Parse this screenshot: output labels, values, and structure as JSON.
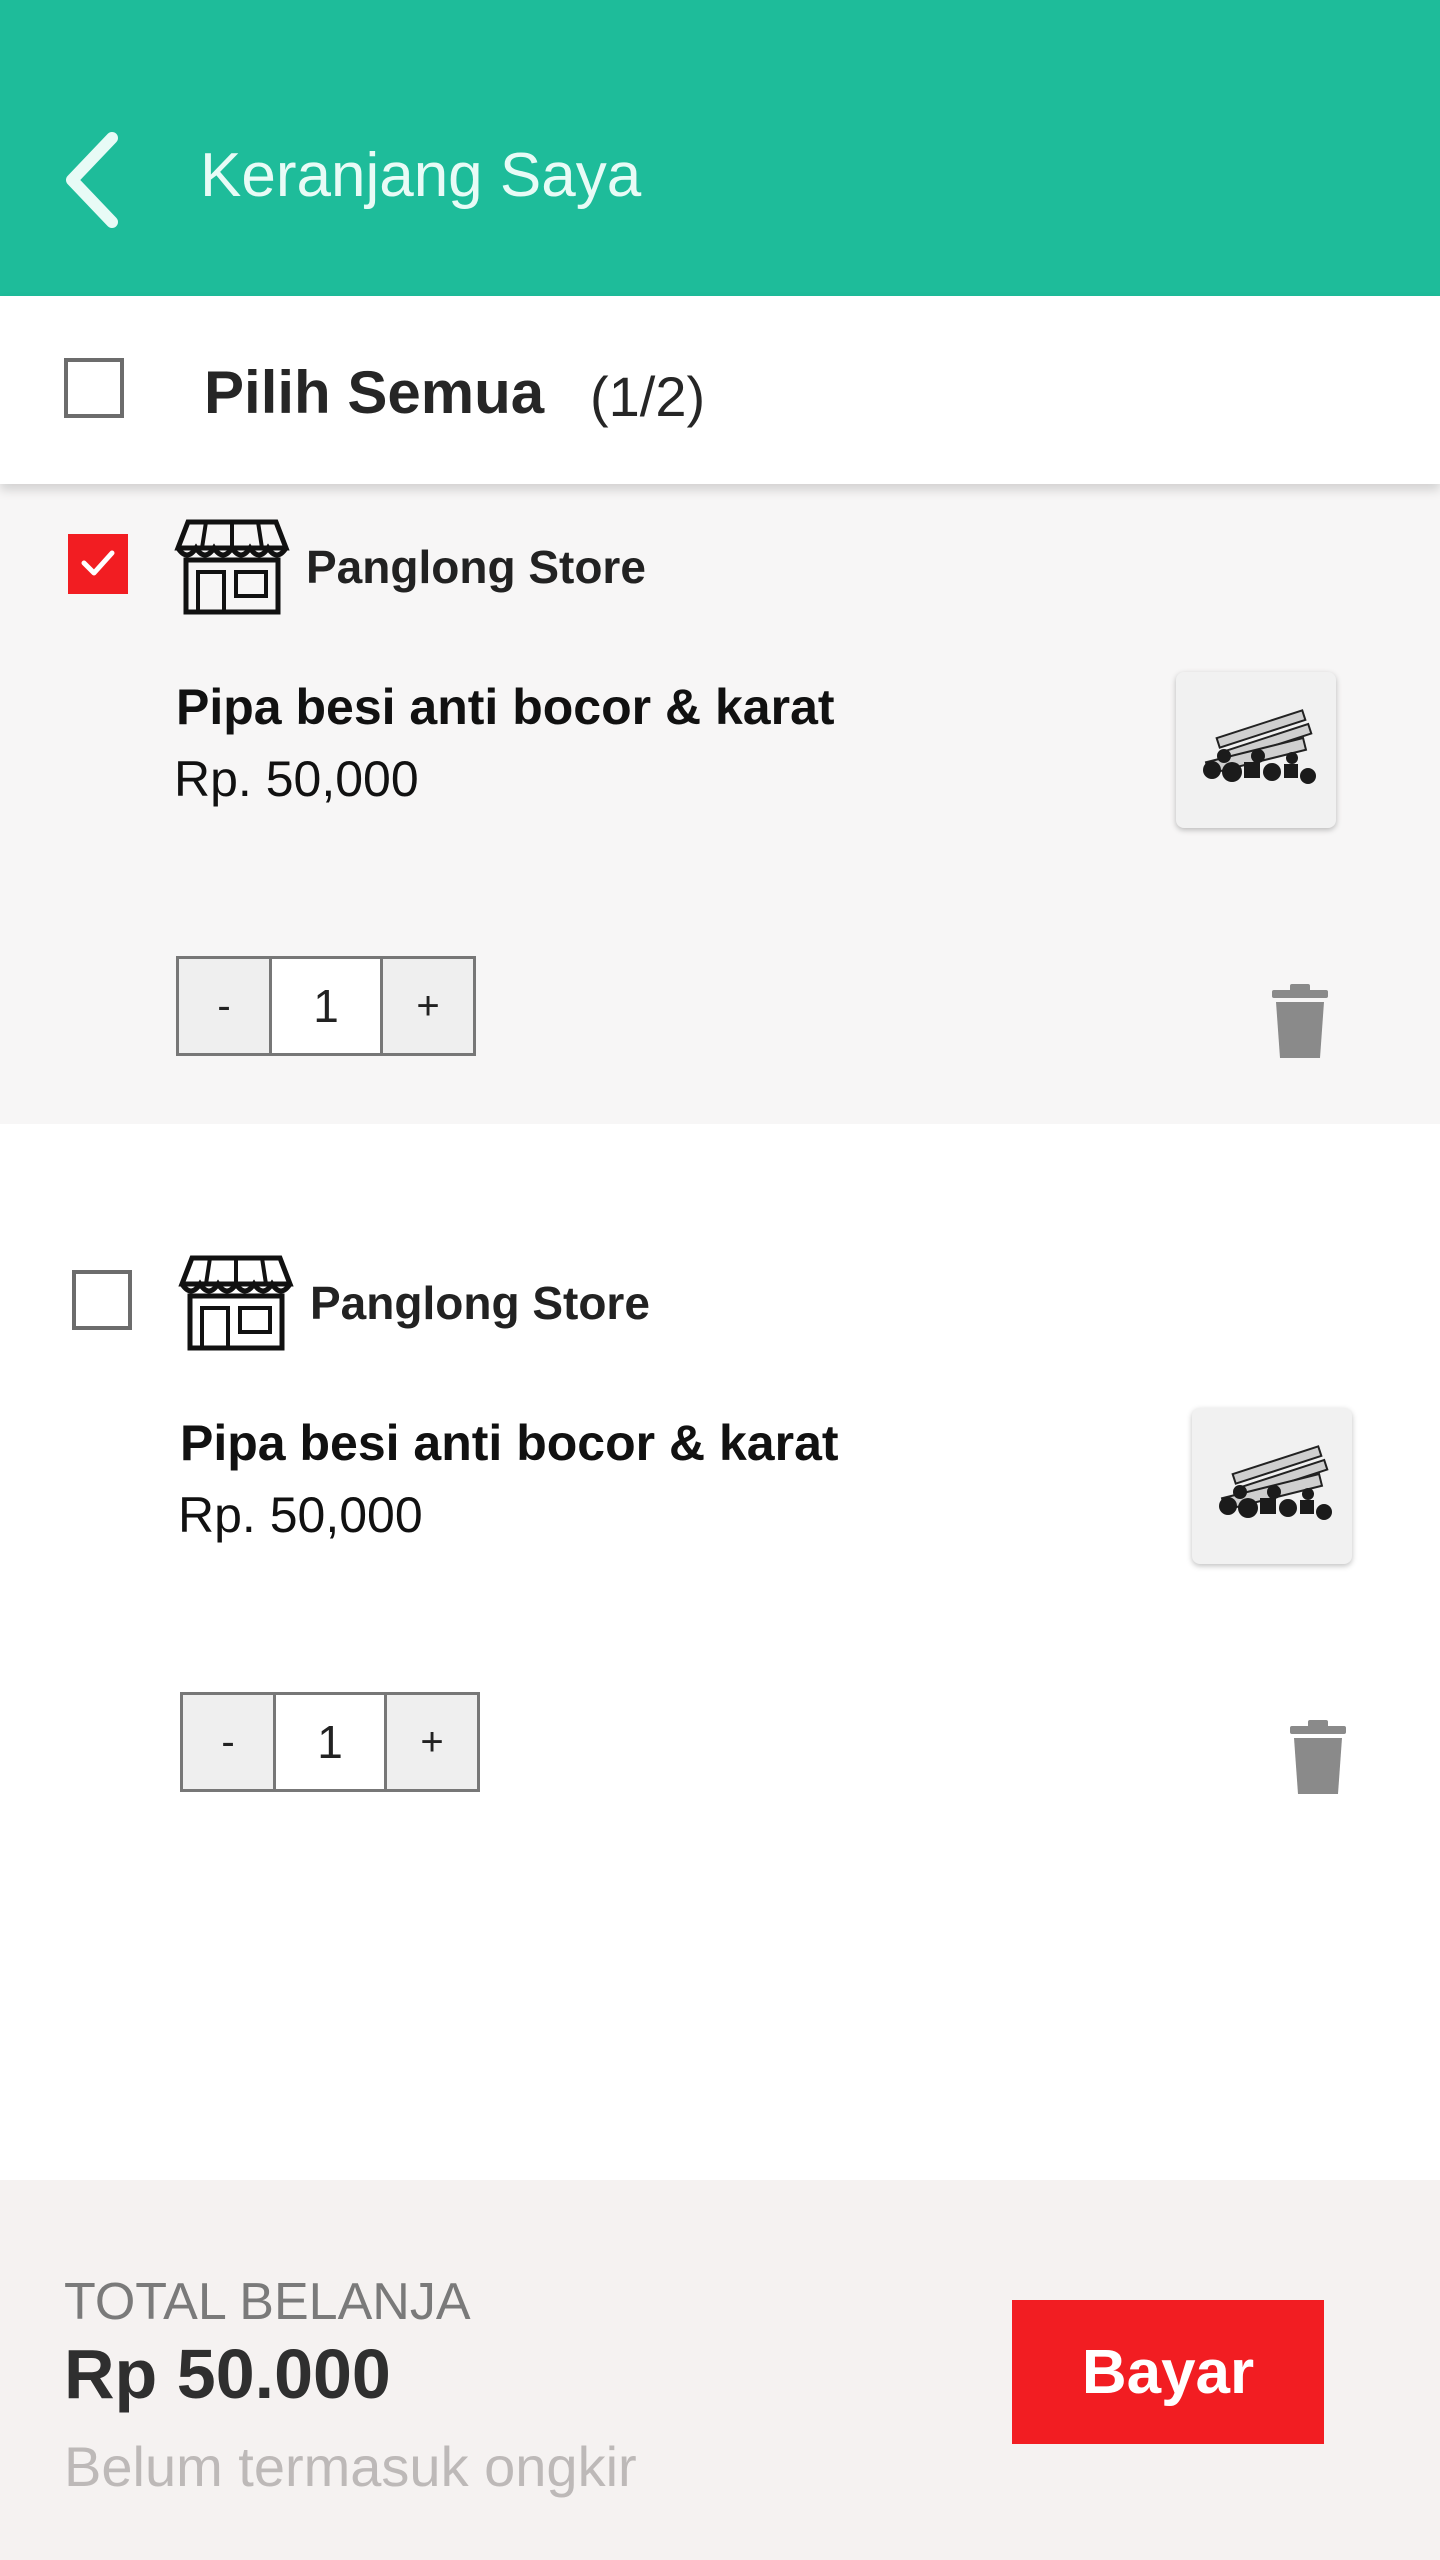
{
  "header": {
    "title": "Keranjang Saya",
    "back_icon": "chevron-left-icon",
    "color": "#1ebc9a"
  },
  "select_all": {
    "label": "Pilih Semua",
    "count": "(1/2)",
    "checked": false
  },
  "items": [
    {
      "checked": true,
      "store_icon": "store-icon",
      "store_name": "Panglong Store",
      "product_name": "Pipa besi anti bocor & karat",
      "price": "Rp. 50,000",
      "quantity": "1",
      "minus_label": "-",
      "plus_label": "+",
      "delete_icon": "trash-icon"
    },
    {
      "checked": false,
      "store_icon": "store-icon",
      "store_name": "Panglong Store",
      "product_name": "Pipa besi anti bocor & karat",
      "price": "Rp. 50,000",
      "quantity": "1",
      "minus_label": "-",
      "plus_label": "+",
      "delete_icon": "trash-icon"
    }
  ],
  "footer": {
    "total_label": "TOTAL BELANJA",
    "total_value": "Rp 50.000",
    "note": "Belum termasuk ongkir",
    "pay_label": "Bayar",
    "pay_color": "#f21d22"
  }
}
